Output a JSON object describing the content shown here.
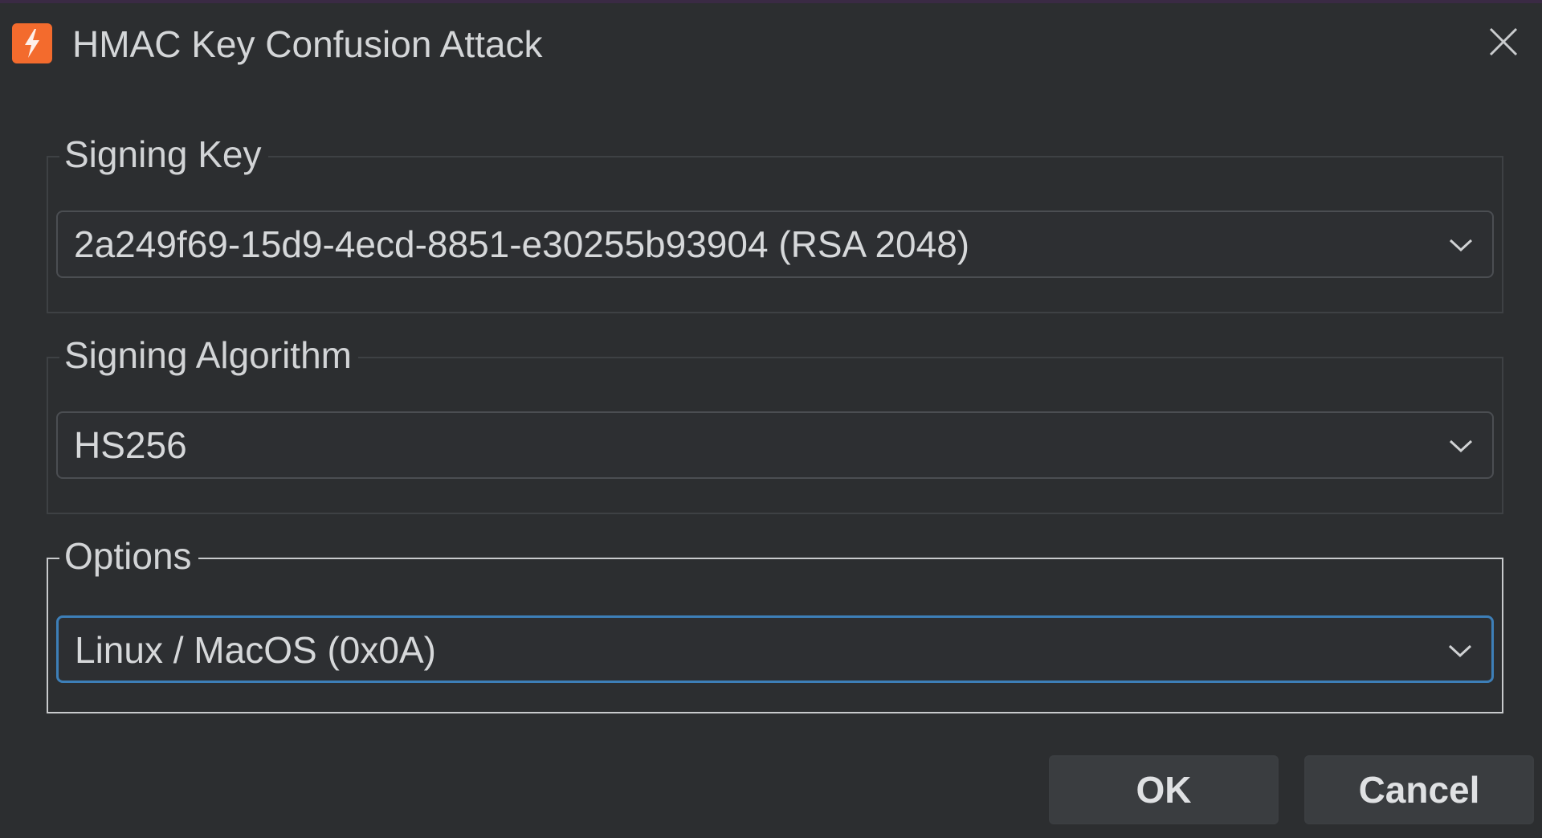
{
  "window": {
    "title": "HMAC Key Confusion Attack",
    "app_icon": "burp-lightning-icon",
    "accent_color": "#f36b2d"
  },
  "signing_key": {
    "legend": "Signing Key",
    "selected": "2a249f69-15d9-4ecd-8851-e30255b93904 (RSA 2048)"
  },
  "signing_algorithm": {
    "legend": "Signing Algorithm",
    "selected": "HS256"
  },
  "options": {
    "legend": "Options",
    "selected": "Linux / MacOS (0x0A)",
    "focus_color": "#3d7fb8"
  },
  "buttons": {
    "ok": "OK",
    "cancel": "Cancel"
  }
}
